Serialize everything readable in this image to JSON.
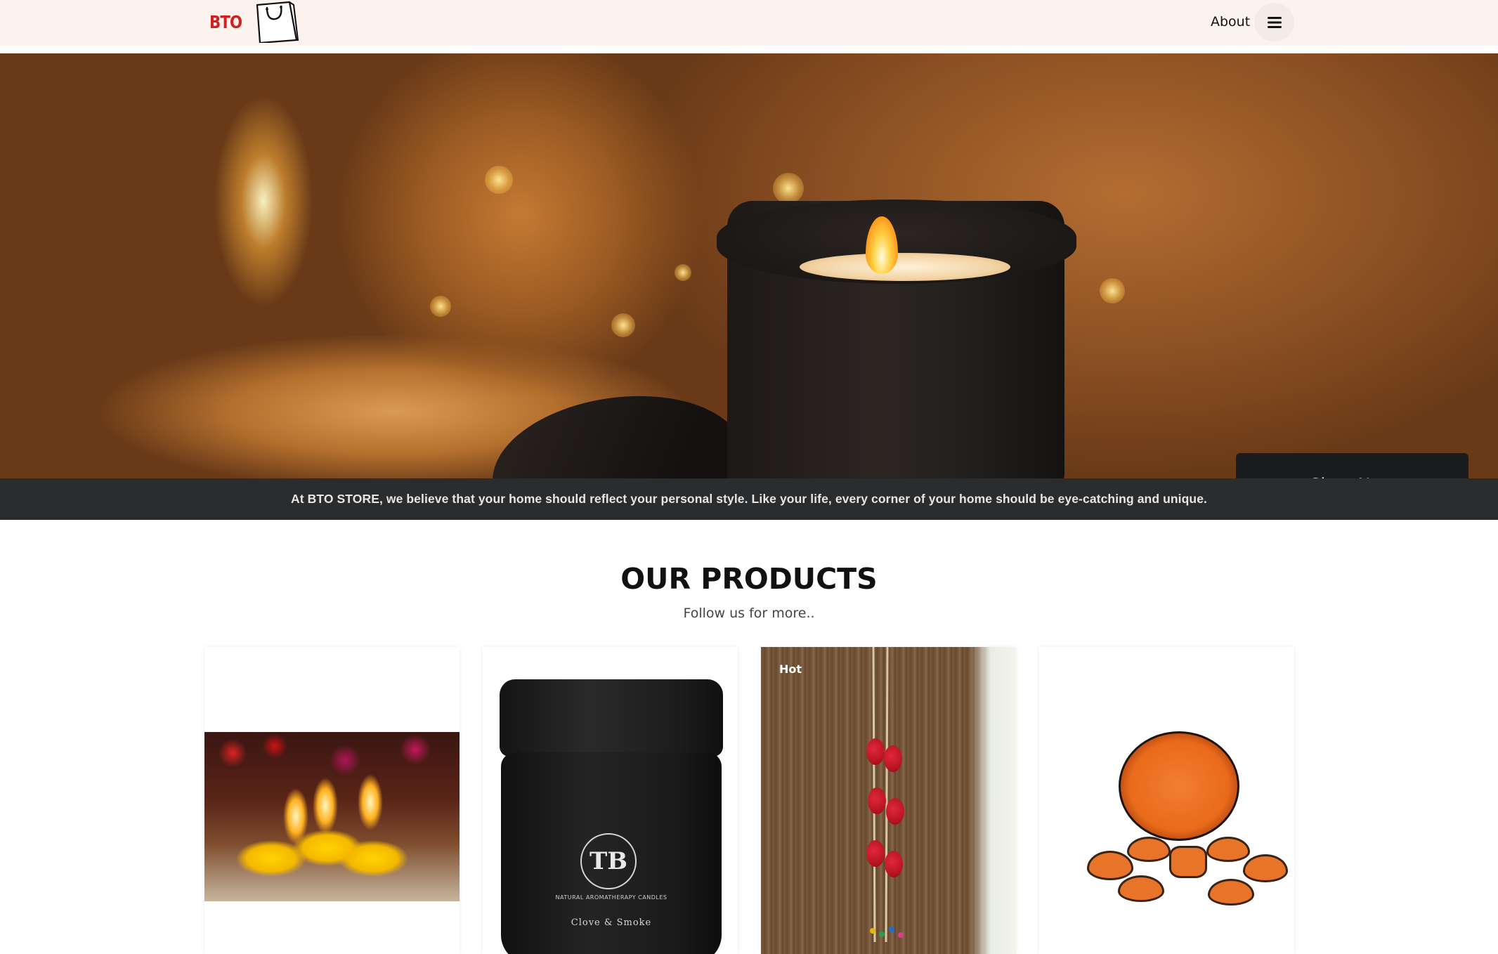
{
  "header": {
    "logo_text": "BTO",
    "about_label": "About",
    "menu_icon": "hamburger-menu-icon"
  },
  "hero": {
    "cta_label": "Shop Now"
  },
  "tagline": "At BTO STORE, we believe that your home should reflect your personal style. Like your life, every corner of your home should be eye-catching and unique.",
  "products_section": {
    "title": "OUR PRODUCTS",
    "subtitle": "Follow us for more..",
    "cards": [
      {
        "badge": "",
        "image": "floating-candles"
      },
      {
        "badge": "",
        "image": "black-candle-jar",
        "jar_lines": [
          "NATURAL AROMATHERAPY CANDLES",
          "Clove & Smoke"
        ],
        "jar_logo": "TB"
      },
      {
        "badge": "Hot",
        "image": "ladybug-wall-hanging"
      },
      {
        "badge": "",
        "image": "orange-platter-set"
      }
    ]
  },
  "colors": {
    "brand_red": "#d11f22",
    "header_bg": "#fdf3ee",
    "dark_band": "#2b2c2e",
    "button_dark": "#1b1c1e"
  }
}
